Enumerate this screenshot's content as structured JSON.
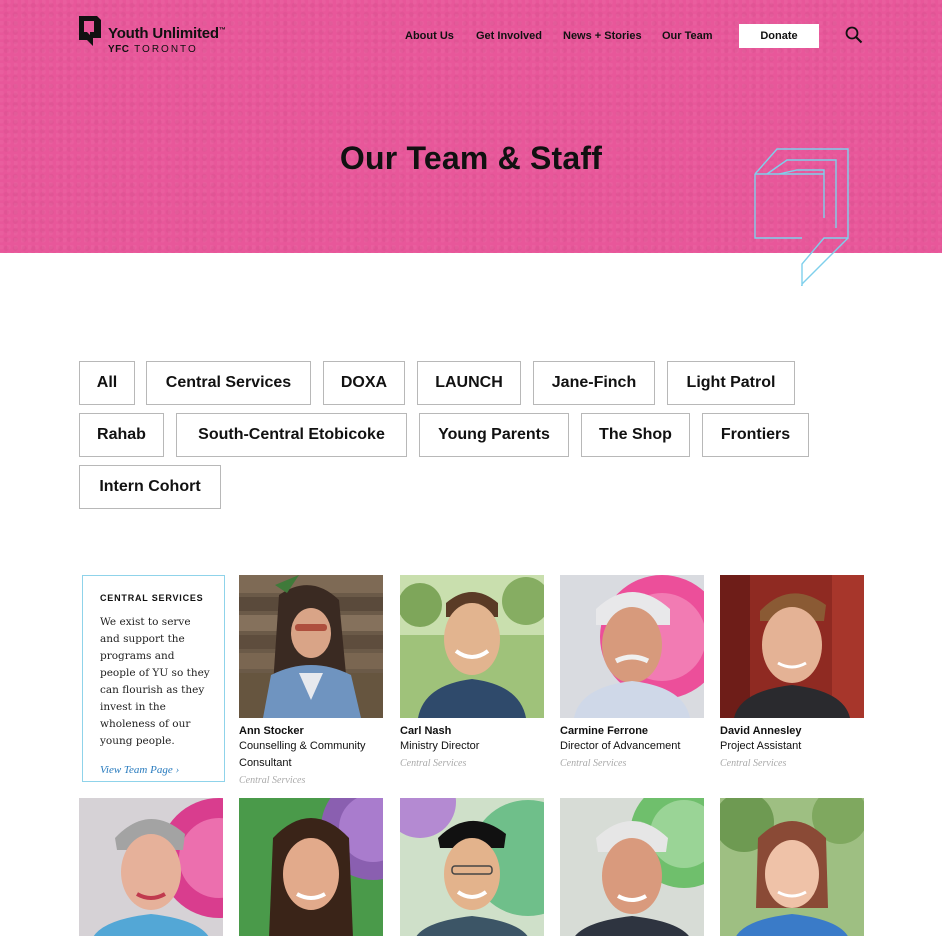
{
  "brand": {
    "title": "Youth Unlimited",
    "tm": "™",
    "sub_bold": "YFC",
    "sub": "TORONTO"
  },
  "nav": {
    "items": [
      "About Us",
      "Get Involved",
      "News + Stories",
      "Our Team"
    ],
    "donate": "Donate"
  },
  "hero": {
    "title": "Our Team & Staff"
  },
  "filters": [
    "All",
    "Central Services",
    "DOXA",
    "LAUNCH",
    "Jane-Finch",
    "Light Patrol",
    "Rahab",
    "South-Central Etobicoke",
    "Young Parents",
    "The Shop",
    "Frontiers",
    "Intern Cohort"
  ],
  "info_card": {
    "heading": "CENTRAL SERVICES",
    "body": "We exist to serve and support the programs and people of YU so they can flourish as they invest in the wholeness of our young people.",
    "link": "View Team Page ›"
  },
  "members": [
    {
      "name": "Ann Stocker",
      "role": "Counselling & Community Consultant",
      "dept": "Central Services"
    },
    {
      "name": "Carl Nash",
      "role": "Ministry Director",
      "dept": "Central Services"
    },
    {
      "name": "Carmine Ferrone",
      "role": "Director of Advancement",
      "dept": "Central Services"
    },
    {
      "name": "David Annesley",
      "role": "Project Assistant",
      "dept": "Central Services"
    }
  ],
  "colors": {
    "hero": "#e8579a",
    "accent_blue": "#8fd3ea",
    "link": "#2a7cbf"
  }
}
